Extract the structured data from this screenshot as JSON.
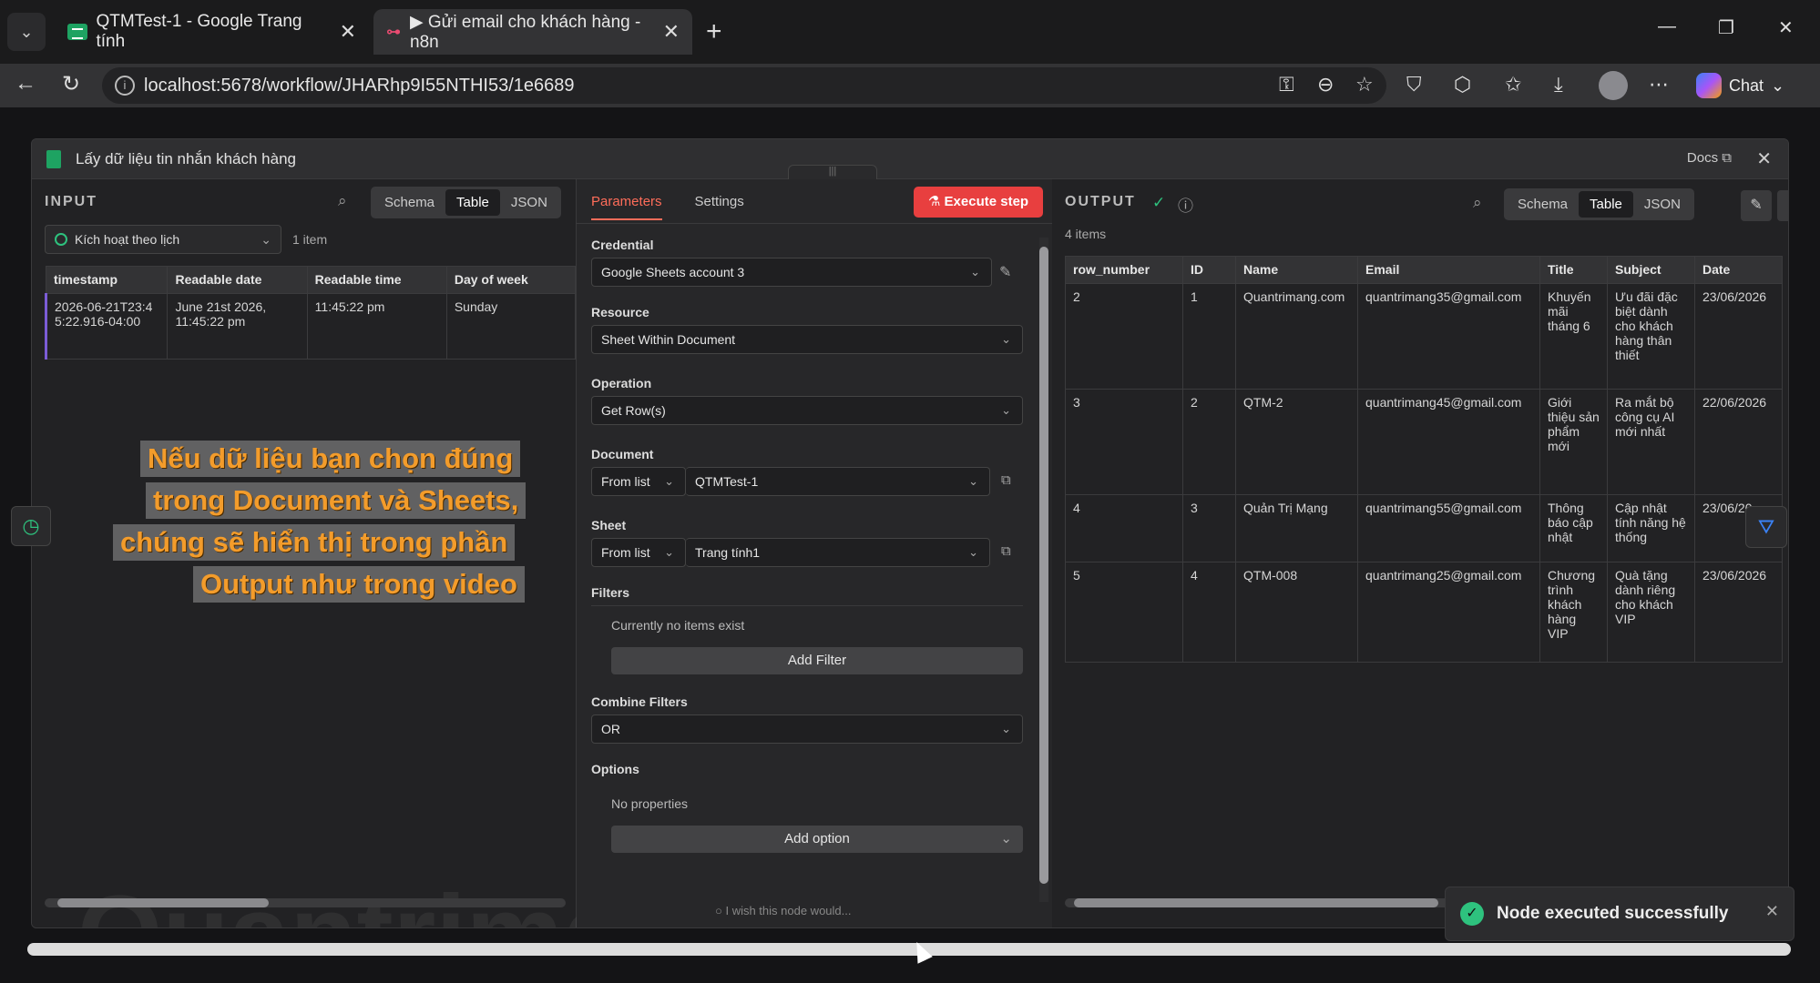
{
  "browser": {
    "tabs": [
      {
        "title": "QTMTest-1 - Google Trang tính",
        "active": false
      },
      {
        "title": "▶ Gửi email cho khách hàng - n8n",
        "active": true
      }
    ],
    "url": "localhost:5678/workflow/JHARhp9I55NTHI53/1e6689",
    "chat_label": "Chat"
  },
  "modal": {
    "title": "Lấy dữ liệu tin nhắn khách hàng",
    "docs_label": "Docs"
  },
  "input": {
    "label": "INPUT",
    "views": [
      "Schema",
      "Table",
      "JSON"
    ],
    "active_view": "Table",
    "trigger": "Kích hoạt theo lịch",
    "count": "1 item",
    "columns": [
      "timestamp",
      "Readable date",
      "Readable time",
      "Day of week"
    ],
    "rows": [
      [
        "2026-06-21T23:45:22.916-04:00",
        "June 21st 2026, 11:45:22 pm",
        "11:45:22 pm",
        "Sunday"
      ]
    ]
  },
  "overlay": {
    "lines": [
      "Nếu dữ liệu bạn chọn đúng",
      "trong Document và Sheets,",
      "chúng sẽ hiển thị trong phần",
      "Output như trong video"
    ]
  },
  "watermark": "Quantrimang",
  "params": {
    "tabs": [
      "Parameters",
      "Settings"
    ],
    "execute_label": "Execute step",
    "credential_label": "Credential",
    "credential_value": "Google Sheets account 3",
    "resource_label": "Resource",
    "resource_value": "Sheet Within Document",
    "operation_label": "Operation",
    "operation_value": "Get Row(s)",
    "document_label": "Document",
    "document_mode": "From list",
    "document_value": "QTMTest-1",
    "sheet_label": "Sheet",
    "sheet_mode": "From list",
    "sheet_value": "Trang tính1",
    "filters_label": "Filters",
    "filters_empty": "Currently no items exist",
    "add_filter": "Add Filter",
    "combine_label": "Combine Filters",
    "combine_value": "OR",
    "options_label": "Options",
    "options_empty": "No properties",
    "add_option": "Add option",
    "footer_hint": "I wish this node would..."
  },
  "output": {
    "label": "OUTPUT",
    "views": [
      "Schema",
      "Table",
      "JSON"
    ],
    "active_view": "Table",
    "count": "4 items",
    "columns": [
      "row_number",
      "ID",
      "Name",
      "Email",
      "Title",
      "Subject",
      "Date"
    ],
    "rows": [
      [
        "2",
        "1",
        "Quantrimang.com",
        "quantrimang35@gmail.com",
        "Khuyến mãi tháng 6",
        "Ưu đãi đặc biệt dành cho khách hàng thân thiết",
        "23/06/2026"
      ],
      [
        "3",
        "2",
        "QTM-2",
        "quantrimang45@gmail.com",
        "Giới thiệu sản phẩm mới",
        "Ra mắt bộ công cụ AI mới nhất",
        "22/06/2026"
      ],
      [
        "4",
        "3",
        "Quản Trị Mạng",
        "quantrimang55@gmail.com",
        "Thông báo cập nhật",
        "Cập nhật tính năng hệ thống",
        "23/06/20"
      ],
      [
        "5",
        "4",
        "QTM-008",
        "quantrimang25@gmail.com",
        "Chương trình khách hàng VIP",
        "Quà tặng dành riêng cho khách VIP",
        "23/06/2026"
      ]
    ]
  },
  "toast": {
    "message": "Node executed successfully"
  }
}
